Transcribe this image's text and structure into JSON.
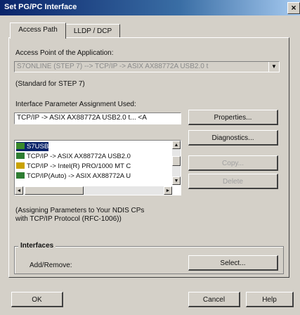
{
  "window": {
    "title": "Set PG/PC Interface",
    "close_glyph": "×"
  },
  "tabs": [
    {
      "label": "Access Path"
    },
    {
      "label": "LLDP / DCP"
    }
  ],
  "access_point": {
    "label": "Access Point of the Application:",
    "value": "S7ONLINE       (STEP 7)       --> TCP/IP -> ASIX AX88772A USB2.0 t",
    "note": "(Standard for STEP 7)"
  },
  "interface_param": {
    "label": "Interface Parameter Assignment Used:",
    "value": "TCP/IP -> ASIX AX88772A USB2.0 t...   <A"
  },
  "interface_list": [
    {
      "label": "S7USB",
      "icon": "usb-adapter-icon",
      "icon_color": "#3a8a2a",
      "selected": true
    },
    {
      "label": "TCP/IP -> ASIX AX88772A USB2.0",
      "icon": "network-adapter-icon",
      "icon_color": "#2e7d32",
      "selected": false
    },
    {
      "label": "TCP/IP -> Intel(R) PRO/1000 MT C",
      "icon": "network-adapter-icon",
      "icon_color": "#c9a200",
      "selected": false
    },
    {
      "label": "TCP/IP(Auto) -> ASIX AX88772A U",
      "icon": "network-adapter-icon",
      "icon_color": "#2e7d32",
      "selected": false
    }
  ],
  "buttons": {
    "properties": "Properties...",
    "diagnostics": "Diagnostics...",
    "copy": "Copy...",
    "delete": "Delete",
    "select": "Select...",
    "ok": "OK",
    "cancel": "Cancel",
    "help": "Help"
  },
  "ndis_note": {
    "line1": "(Assigning Parameters to Your NDIS CPs",
    "line2": "with TCP/IP Protocol (RFC-1006))"
  },
  "interfaces_group": {
    "title": "Interfaces",
    "add_remove_label": "Add/Remove:"
  },
  "colors": {
    "titlebar_start": "#0a246a",
    "titlebar_end": "#a6caf0",
    "selection": "#0a246a"
  }
}
